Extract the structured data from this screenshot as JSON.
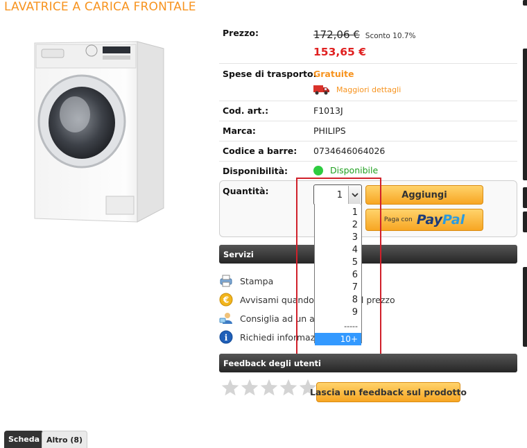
{
  "product": {
    "title": "LAVATRICE A CARICA FRONTALE",
    "image_alt": "washing-machine-image"
  },
  "details": {
    "price_label": "Prezzo:",
    "price_old": "172,06 €",
    "discount": "Sconto 10.7%",
    "price_new": "153,65 €",
    "shipping_label": "Spese di trasporto:",
    "shipping_value": "Gratuite",
    "shipping_more": "Maggiori dettagli",
    "code_label": "Cod. art.:",
    "code_value": "F1013J",
    "brand_label": "Marca:",
    "brand_value": "PHILIPS",
    "barcode_label": "Codice a barre:",
    "barcode_value": "0734646064026",
    "availability_label": "Disponibilità:",
    "availability_value": "Disponibile"
  },
  "quantity": {
    "label": "Quantità:",
    "selected": "1",
    "options": [
      "1",
      "2",
      "3",
      "4",
      "5",
      "6",
      "7",
      "8",
      "9",
      "-----",
      "10+"
    ],
    "highlighted_option": "10+"
  },
  "buttons": {
    "add": "Aggiungi",
    "paypal_prefix": "Paga con",
    "paypal_pay": "Pay",
    "paypal_pal": "Pal"
  },
  "services": {
    "title": "Servizi",
    "items": [
      {
        "label": "Stampa",
        "icon": "printer-icon"
      },
      {
        "label": "Avvisami quando",
        "suffix": "l prezzo",
        "icon": "euro-coin-icon"
      },
      {
        "label": "Consiglia ad un a",
        "suffix": "",
        "icon": "recommend-user-icon"
      },
      {
        "label": "Richiedi informazi",
        "suffix": "",
        "icon": "info-icon"
      }
    ]
  },
  "feedback": {
    "title": "Feedback degli utenti",
    "button": "Lascia un feedback sul prodotto",
    "rating": 0,
    "max_rating": 5
  },
  "tabs": [
    {
      "label": "Scheda",
      "active": true
    },
    {
      "label": "Altro (8)",
      "active": false
    }
  ],
  "colors": {
    "accent": "#f7931e",
    "price_red": "#e02020",
    "available_green": "#21a021",
    "selection_blue": "#3399ff",
    "highlight_red": "#d0202a"
  }
}
